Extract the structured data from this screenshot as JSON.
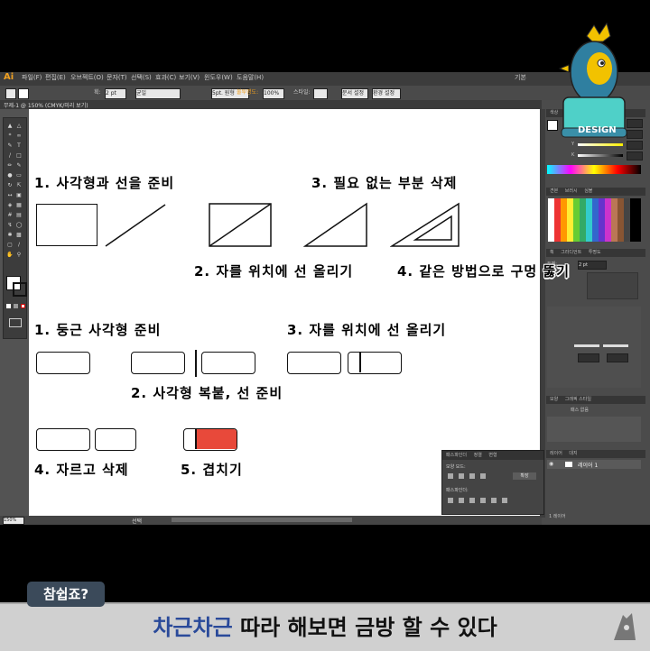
{
  "app": {
    "logo": "Ai",
    "menus": [
      "파일(F)",
      "편집(E)",
      "오브젝트(O)",
      "문자(T)",
      "선택(S)",
      "효과(C)",
      "보기(V)",
      "윈도우(W)",
      "도움말(H)"
    ],
    "workspace_label": "기본",
    "document_tab": "무제-1 @ 150% (CMYK/미리 보기)",
    "zoom": "150%",
    "status_right": "선택"
  },
  "control_bar": {
    "stroke_label": "획:",
    "stroke_value": "2 pt",
    "uniform": "균일",
    "brush": "5pt. 원형",
    "opacity_label": "불투명도:",
    "opacity_value": "100%",
    "style_label": "스타일:",
    "doc_setup": "문서 설정",
    "prefs": "환경 설정"
  },
  "canvas": {
    "steps_top": {
      "s1": "1. 사각형과 선을 준비",
      "s2": "2. 자를 위치에 선 올리기",
      "s3": "3. 필요 없는 부분 삭제",
      "s4": "4. 같은 방법으로 구멍 뚫기"
    },
    "steps_bottom": {
      "s1": "1. 둥근 사각형 준비",
      "s2": "2. 사각형 복붙, 선 준비",
      "s3": "3. 자를 위치에 선 올리기",
      "s4": "4. 자르고 삭제",
      "s5": "5. 겹치기"
    },
    "fill_accent": "#e8493a"
  },
  "right_panels": {
    "color_tab": "색상",
    "swatch_tabs": [
      "견본",
      "브러시",
      "심볼"
    ],
    "gradient_tabs": [
      "획",
      "그라디언트",
      "투명도"
    ],
    "stroke_weight_label": "두께:",
    "stroke_weight_value": "2 pt",
    "appearance_tabs": [
      "모양",
      "그래픽 스타일"
    ],
    "appearance_title": "패스 없음",
    "layers_tabs": [
      "레이어",
      "대지"
    ],
    "layer_name": "레이어 1",
    "layers_count": "1 레이어",
    "pathfinder_tabs": [
      "패스파인더",
      "정렬",
      "변형"
    ],
    "pathfinder_mode": "모양 모드:",
    "pathfinder_label": "패스파인더:",
    "expand_button": "확장"
  },
  "mascot": {
    "label": "DESIGN"
  },
  "banner": {
    "badge": "참쉽죠?",
    "highlight": "차근차근",
    "rest": " 따라 해보면 금방 할 수 있다"
  }
}
